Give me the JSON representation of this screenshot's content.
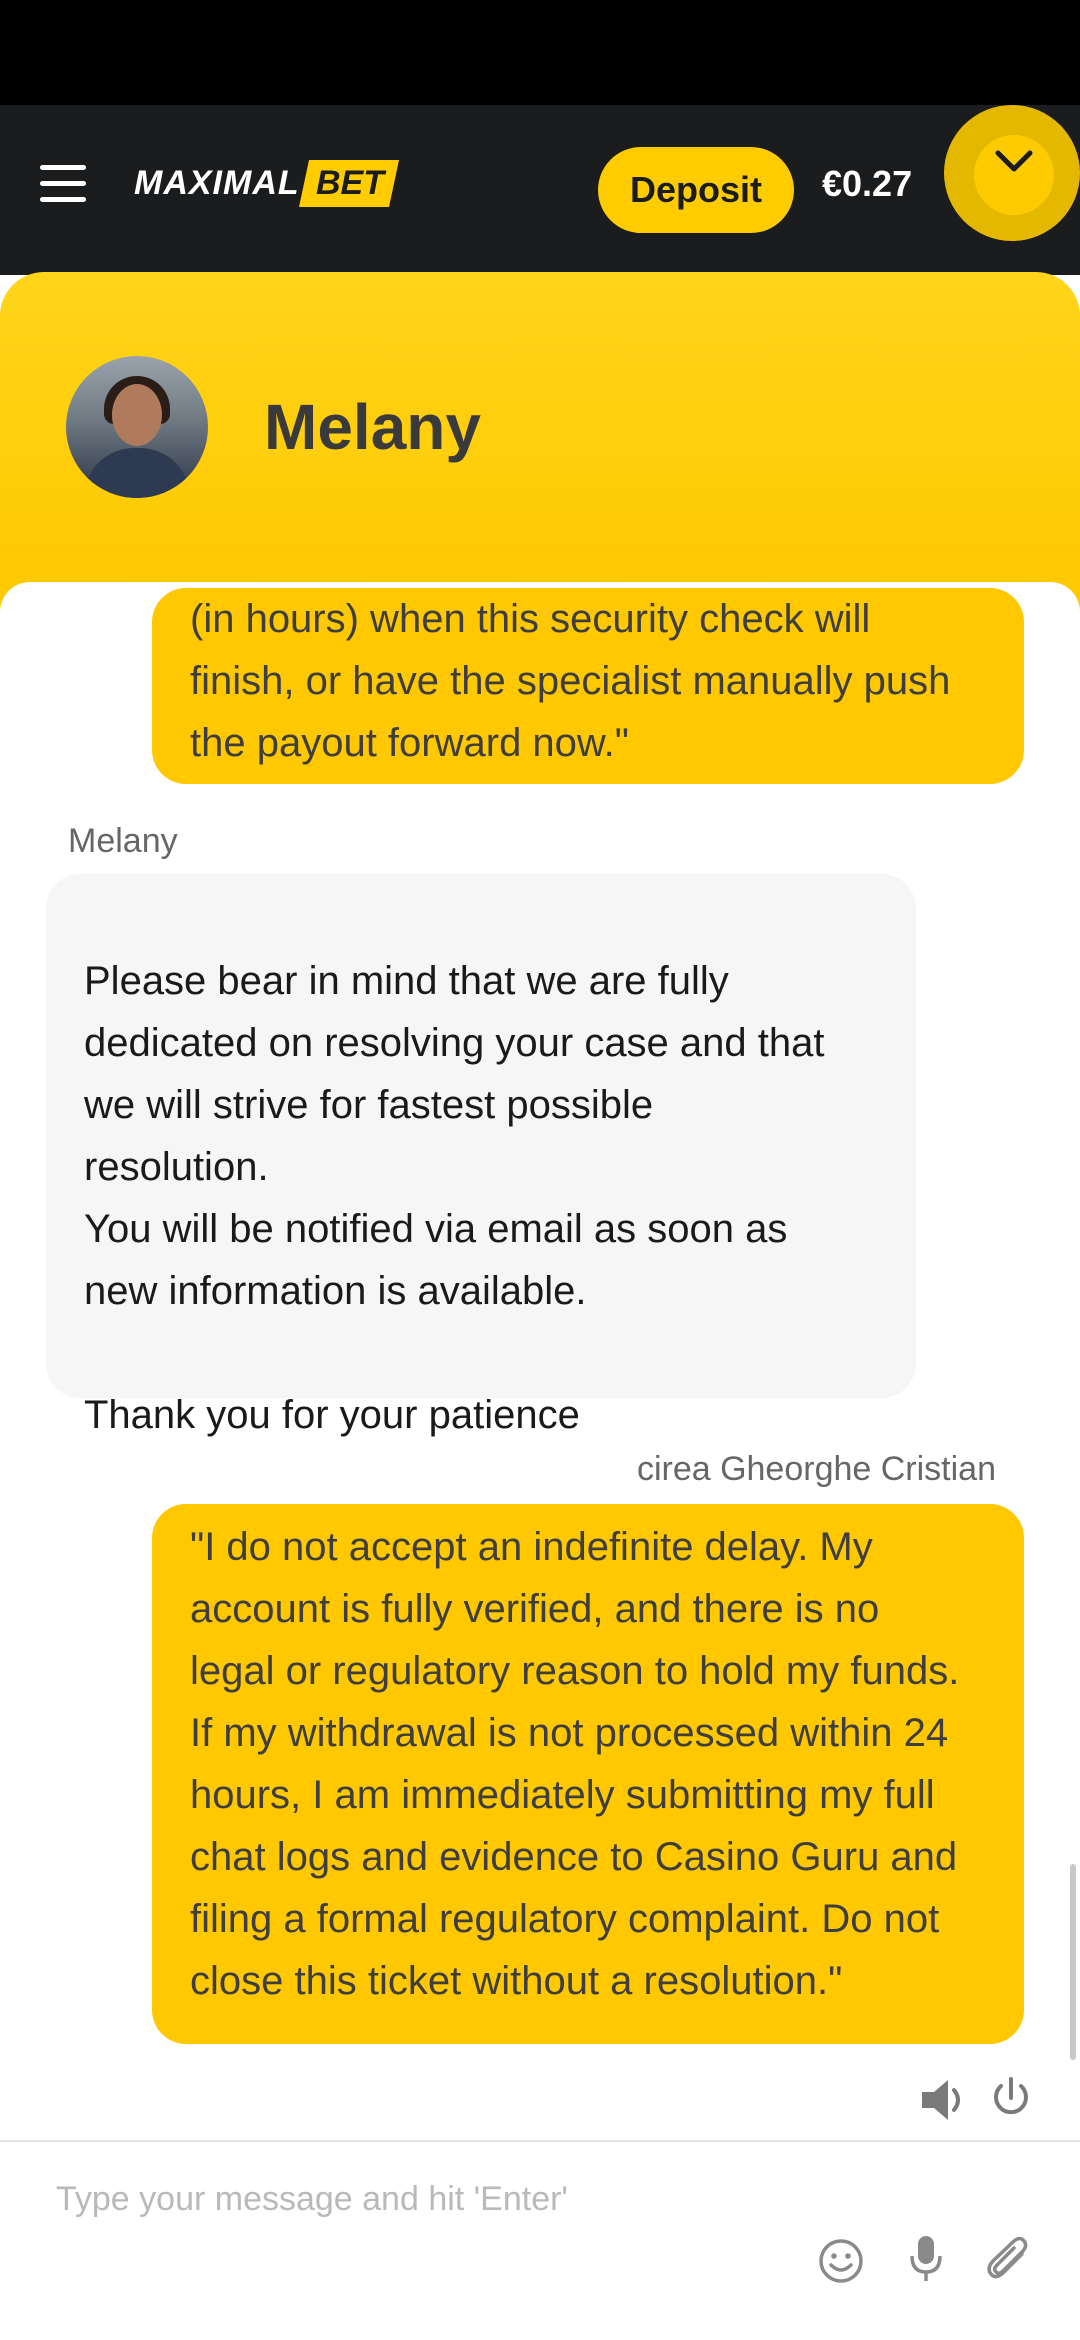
{
  "header": {
    "logo_part1": "MAXIMAL",
    "logo_part2": "BET",
    "deposit_label": "Deposit",
    "balance": "€0.27"
  },
  "chat": {
    "agent_name": "Melany",
    "messages": [
      {
        "type": "user",
        "text": "(in hours) when this security check will\nfinish, or have the specialist manually push\nthe payout forward now.\""
      },
      {
        "type": "agent",
        "sender": "Melany",
        "text": "Please bear in mind that we are fully\ndedicated on resolving your case and that\nwe will strive for fastest possible\nresolution.\nYou will be notified via email as soon as\nnew information is available.\n\nThank you for your patience"
      },
      {
        "type": "user",
        "sender": "cirea Gheorghe Cristian",
        "text": "\"I do not accept an indefinite delay. My\naccount is fully verified, and there is no\nlegal or regulatory reason to hold my funds.\nIf my withdrawal is not processed within 24\nhours, I am immediately submitting my full\nchat logs and evidence to Casino Guru and\nfiling a formal regulatory complaint. Do not\nclose this ticket without a resolution.\""
      }
    ],
    "input_placeholder": "Type your message and hit 'Enter'"
  },
  "icons": {
    "menu": "hamburger-icon",
    "user": "chevron-down-icon",
    "sound": "speaker-icon",
    "power": "power-icon",
    "emoji": "smiley-icon",
    "mic": "microphone-icon",
    "attach": "paperclip-icon"
  },
  "colors": {
    "accent": "#ffc800",
    "topbar": "#1b1c1e"
  }
}
